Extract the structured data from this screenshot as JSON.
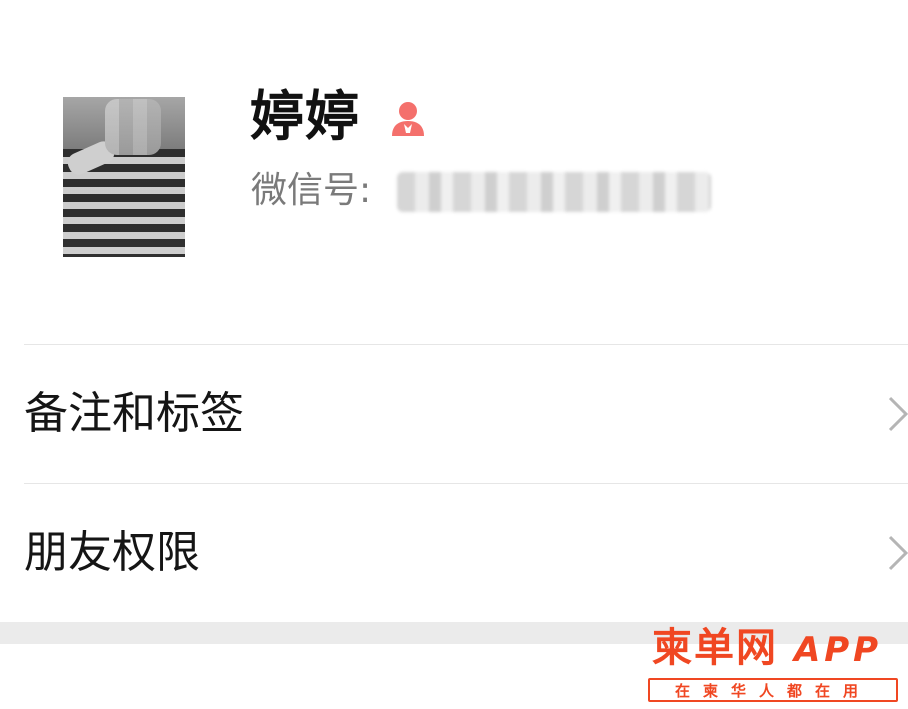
{
  "profile": {
    "name": "婷婷",
    "gender_icon": "female-icon",
    "wechat_label": "微信号:",
    "wechat_id": "",
    "avatar": "blurred-photo"
  },
  "menu": [
    {
      "label": "备注和标签",
      "icon": "chevron-right-icon"
    },
    {
      "label": "朋友权限",
      "icon": "chevron-right-icon"
    }
  ],
  "watermark": {
    "brand": "柬单网",
    "app": "APP",
    "slogan": "在柬华人都在用"
  },
  "colors": {
    "accent": "#f04722",
    "gender": "#f4706c",
    "divider": "#e6e6e6",
    "band": "#ebebeb"
  }
}
